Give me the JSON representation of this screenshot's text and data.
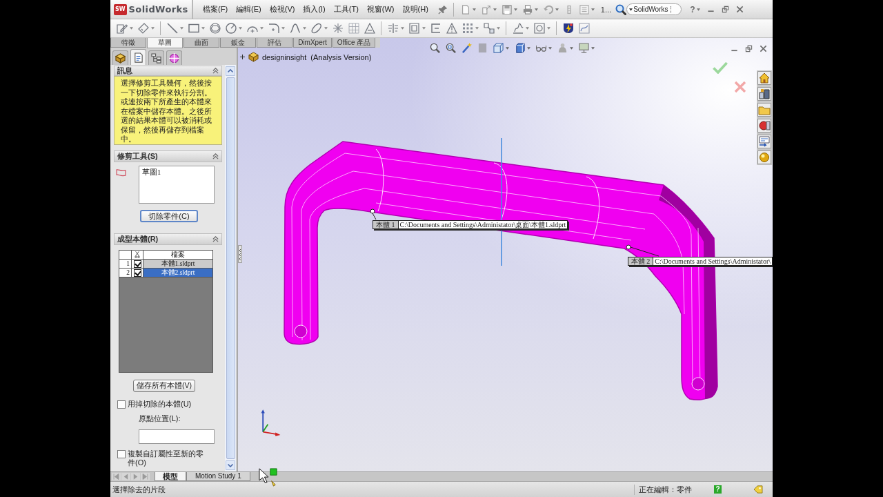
{
  "app": {
    "logo_mark": "SW",
    "name": "SolidWorks"
  },
  "menu": [
    "檔案(F)",
    "編輯(E)",
    "檢視(V)",
    "插入(I)",
    "工具(T)",
    "視窗(W)",
    "說明(H)"
  ],
  "window": {
    "title": "1..."
  },
  "search": {
    "scope": "SolidWorks"
  },
  "help": "?",
  "command_tabs": [
    {
      "label": "特徵",
      "selected": false
    },
    {
      "label": "草圖",
      "selected": true
    },
    {
      "label": "曲面",
      "selected": false
    },
    {
      "label": "鈑金",
      "selected": false
    },
    {
      "label": "評估",
      "selected": false
    },
    {
      "label": "DimXpert",
      "selected": false
    },
    {
      "label": "Office 產品",
      "selected": false
    }
  ],
  "property_manager": {
    "tabs": [
      {
        "kind": "feature-tree",
        "selected": false
      },
      {
        "kind": "property",
        "selected": true
      },
      {
        "kind": "configuration",
        "selected": false
      },
      {
        "kind": "dimxpert",
        "selected": false
      }
    ],
    "message": {
      "title": "訊息",
      "text": "選擇修剪工具幾何，然後按一下切除零件來執行分割。或連按兩下所產生的本體來在檔案中儲存本體。之後所選的結果本體可以被消耗或保留，然後再儲存到檔案中。"
    },
    "trim_tool": {
      "title": "修剪工具(S)",
      "items": [
        "草圖1"
      ],
      "button": "切除零件(C)"
    },
    "bodies": {
      "title": "成型本體(R)",
      "columns": [
        "檔案"
      ],
      "rows": [
        {
          "index": "1",
          "checked": true,
          "file": "本體1.sldprt",
          "selected": false
        },
        {
          "index": "2",
          "checked": true,
          "file": "本體2.sldprt",
          "selected": true
        }
      ],
      "button": "儲存所有本體(V)"
    },
    "options": [
      {
        "kind": "checkbox",
        "label": "用掉切除的本體(U)",
        "checked": false
      },
      {
        "kind": "field",
        "label": "原點位置(L):"
      },
      {
        "kind": "checkbox",
        "label": "複製自訂屬性至新的零件(O)",
        "checked": false
      }
    ]
  },
  "viewport": {
    "tree_item": {
      "label": "designinsight  (Analysis Version)",
      "expanded": false
    },
    "callouts": [
      {
        "label": "本體 1",
        "path": "C:\\Documents and Settings\\Administator\\桌面\\本體1.sldprt"
      },
      {
        "label": "本體 2",
        "path": "C:\\Documents and Settings\\Administator\\"
      }
    ]
  },
  "bottom_tabs": [
    {
      "label": "模型",
      "selected": true
    },
    {
      "label": "Motion Study 1",
      "selected": false
    }
  ],
  "status_bar": {
    "message": "選擇除去的片段",
    "mode": "正在編輯：零件",
    "help": "?"
  }
}
